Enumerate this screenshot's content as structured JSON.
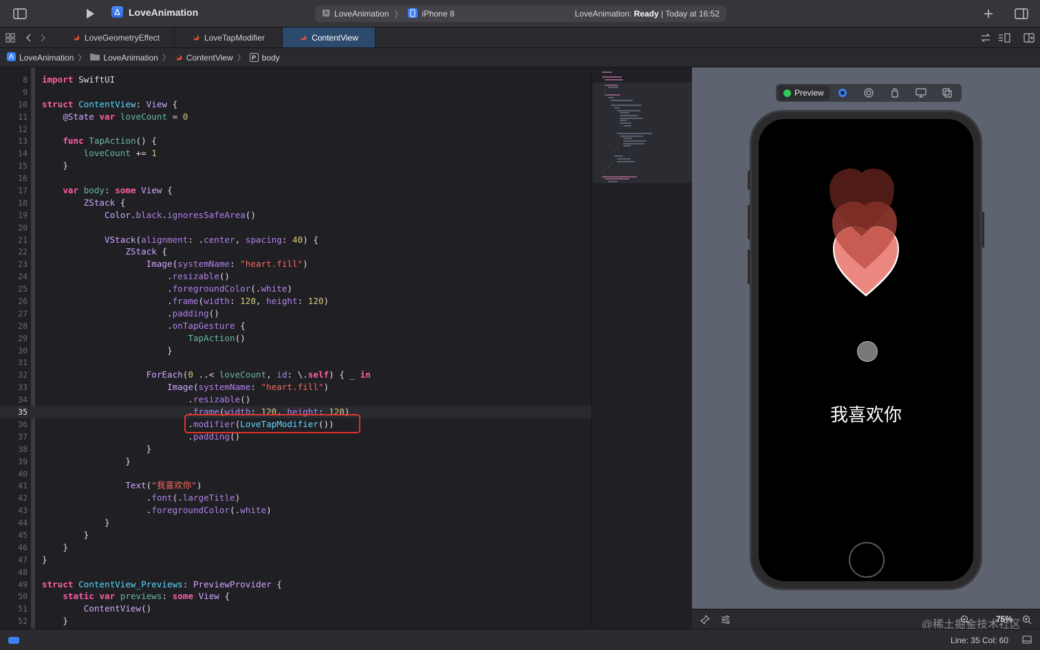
{
  "toolbar": {
    "app_title": "LoveAnimation",
    "scheme": "LoveAnimation",
    "device": "iPhone 8",
    "status_prefix": "LoveAnimation: ",
    "status_state": "Ready",
    "status_time": " | Today at 16:52"
  },
  "tabs": [
    {
      "label": "LoveGeometryEffect"
    },
    {
      "label": "LoveTapModifier"
    },
    {
      "label": "ContentView"
    }
  ],
  "breadcrumb": [
    "LoveAnimation",
    "LoveAnimation",
    "ContentView",
    "body"
  ],
  "editor": {
    "current_line": 35,
    "lines": [
      {
        "n": "8",
        "code": "<span class=\"kw\">import</span> SwiftUI"
      },
      {
        "n": "9",
        "code": ""
      },
      {
        "n": "10",
        "code": "<span class=\"kw\">struct</span> <span class=\"uty\">ContentView</span>: <span class=\"ty\">View</span> {"
      },
      {
        "n": "11",
        "code": "    <span class=\"ty\">@State</span> <span class=\"kw\">var</span> <span class=\"fn\">loveCount</span> = <span class=\"num\">0</span>"
      },
      {
        "n": "12",
        "code": ""
      },
      {
        "n": "13",
        "code": "    <span class=\"kw\">func</span> <span class=\"fn\">TapAction</span>() {"
      },
      {
        "n": "14",
        "code": "        <span class=\"fn\">loveCount</span> += <span class=\"num\">1</span>"
      },
      {
        "n": "15",
        "code": "    }"
      },
      {
        "n": "16",
        "code": ""
      },
      {
        "n": "17",
        "code": "    <span class=\"kw\">var</span> <span class=\"fn\">body</span>: <span class=\"kw\">some</span> <span class=\"ty\">View</span> {"
      },
      {
        "n": "18",
        "code": "        <span class=\"ty\">ZStack</span> {"
      },
      {
        "n": "19",
        "code": "            <span class=\"ty\">Color</span>.<span class=\"pr\">black</span>.<span class=\"pr\">ignoresSafeArea</span>()"
      },
      {
        "n": "20",
        "code": ""
      },
      {
        "n": "21",
        "code": "            <span class=\"ty\">VStack</span>(<span class=\"pr\">alignment</span>: .<span class=\"pr\">center</span>, <span class=\"pr\">spacing</span>: <span class=\"num\">40</span>) {"
      },
      {
        "n": "22",
        "code": "                <span class=\"ty\">ZStack</span> {"
      },
      {
        "n": "23",
        "code": "                    <span class=\"ty\">Image</span>(<span class=\"pr\">systemName</span>: <span class=\"str\">\"heart.fill\"</span>)"
      },
      {
        "n": "24",
        "code": "                        .<span class=\"pr\">resizable</span>()"
      },
      {
        "n": "25",
        "code": "                        .<span class=\"pr\">foregroundColor</span>(.<span class=\"pr\">white</span>)"
      },
      {
        "n": "26",
        "code": "                        .<span class=\"pr\">frame</span>(<span class=\"pr\">width</span>: <span class=\"num\">120</span>, <span class=\"pr\">height</span>: <span class=\"num\">120</span>)"
      },
      {
        "n": "27",
        "code": "                        .<span class=\"pr\">padding</span>()"
      },
      {
        "n": "28",
        "code": "                        .<span class=\"pr\">onTapGesture</span> {"
      },
      {
        "n": "29",
        "code": "                            <span class=\"fn\">TapAction</span>()"
      },
      {
        "n": "30",
        "code": "                        }"
      },
      {
        "n": "31",
        "code": ""
      },
      {
        "n": "32",
        "code": "                    <span class=\"ty\">ForEach</span>(<span class=\"num\">0</span> ..&lt; <span class=\"fn\">loveCount</span>, <span class=\"pr\">id</span>: \\.<span class=\"kw\">self</span>) { _ <span class=\"kw\">in</span>"
      },
      {
        "n": "33",
        "code": "                        <span class=\"ty\">Image</span>(<span class=\"pr\">systemName</span>: <span class=\"str\">\"heart.fill\"</span>)"
      },
      {
        "n": "34",
        "code": "                            .<span class=\"pr\">resizable</span>()"
      },
      {
        "n": "35",
        "code": "                            .<span class=\"pr\">frame</span>(<span class=\"pr\">width</span>: <span class=\"num\">120</span>, <span class=\"pr\">height</span>: <span class=\"num\">120</span>)"
      },
      {
        "n": "36",
        "code": "                            .<span class=\"pr\">modifier</span>(<span class=\"uty\">LoveTapModifier</span>())"
      },
      {
        "n": "37",
        "code": "                            .<span class=\"pr\">padding</span>()"
      },
      {
        "n": "38",
        "code": "                    }"
      },
      {
        "n": "39",
        "code": "                }"
      },
      {
        "n": "40",
        "code": ""
      },
      {
        "n": "41",
        "code": "                <span class=\"ty\">Text</span>(<span class=\"str\">\"我喜欢你\"</span>)"
      },
      {
        "n": "42",
        "code": "                    .<span class=\"pr\">font</span>(.<span class=\"pr\">largeTitle</span>)"
      },
      {
        "n": "43",
        "code": "                    .<span class=\"pr\">foregroundColor</span>(.<span class=\"pr\">white</span>)"
      },
      {
        "n": "44",
        "code": "            }"
      },
      {
        "n": "45",
        "code": "        }"
      },
      {
        "n": "46",
        "code": "    }"
      },
      {
        "n": "47",
        "code": "}"
      },
      {
        "n": "48",
        "code": ""
      },
      {
        "n": "49",
        "code": "<span class=\"kw\">struct</span> <span class=\"uty\">ContentView_Previews</span>: <span class=\"ty\">PreviewProvider</span> {"
      },
      {
        "n": "50",
        "code": "    <span class=\"kw\">static</span> <span class=\"kw\">var</span> <span class=\"fn\">previews</span>: <span class=\"kw\">some</span> <span class=\"ty\">View</span> {"
      },
      {
        "n": "51",
        "code": "        <span class=\"ty\">ContentView</span>()"
      },
      {
        "n": "52",
        "code": "    }"
      }
    ]
  },
  "preview": {
    "label": "Preview",
    "text": "我喜欢你",
    "zoom": "75%",
    "watermark": "@稀土掘金技术社区"
  },
  "statusbar": {
    "line_col": "Line: 35  Col: 60"
  },
  "colors": {
    "accent": "#3a82f7",
    "highlight": "#e0352b",
    "ready_green": "#34c759"
  }
}
